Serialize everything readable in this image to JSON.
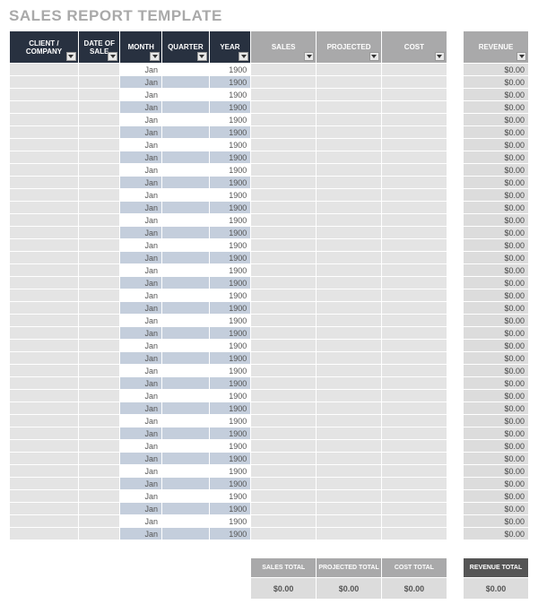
{
  "title": "SALES REPORT TEMPLATE",
  "headers": {
    "client": "CLIENT / COMPANY",
    "date": "DATE OF SALE",
    "month": "MONTH",
    "quarter": "QUARTER",
    "year": "YEAR",
    "sales": "SALES",
    "projected": "PROJECTED",
    "cost": "COST",
    "revenue": "REVENUE"
  },
  "rows": [
    {
      "month": "Jan",
      "year": "1900",
      "revenue": "$0.00"
    },
    {
      "month": "Jan",
      "year": "1900",
      "revenue": "$0.00"
    },
    {
      "month": "Jan",
      "year": "1900",
      "revenue": "$0.00"
    },
    {
      "month": "Jan",
      "year": "1900",
      "revenue": "$0.00"
    },
    {
      "month": "Jan",
      "year": "1900",
      "revenue": "$0.00"
    },
    {
      "month": "Jan",
      "year": "1900",
      "revenue": "$0.00"
    },
    {
      "month": "Jan",
      "year": "1900",
      "revenue": "$0.00"
    },
    {
      "month": "Jan",
      "year": "1900",
      "revenue": "$0.00"
    },
    {
      "month": "Jan",
      "year": "1900",
      "revenue": "$0.00"
    },
    {
      "month": "Jan",
      "year": "1900",
      "revenue": "$0.00"
    },
    {
      "month": "Jan",
      "year": "1900",
      "revenue": "$0.00"
    },
    {
      "month": "Jan",
      "year": "1900",
      "revenue": "$0.00"
    },
    {
      "month": "Jan",
      "year": "1900",
      "revenue": "$0.00"
    },
    {
      "month": "Jan",
      "year": "1900",
      "revenue": "$0.00"
    },
    {
      "month": "Jan",
      "year": "1900",
      "revenue": "$0.00"
    },
    {
      "month": "Jan",
      "year": "1900",
      "revenue": "$0.00"
    },
    {
      "month": "Jan",
      "year": "1900",
      "revenue": "$0.00"
    },
    {
      "month": "Jan",
      "year": "1900",
      "revenue": "$0.00"
    },
    {
      "month": "Jan",
      "year": "1900",
      "revenue": "$0.00"
    },
    {
      "month": "Jan",
      "year": "1900",
      "revenue": "$0.00"
    },
    {
      "month": "Jan",
      "year": "1900",
      "revenue": "$0.00"
    },
    {
      "month": "Jan",
      "year": "1900",
      "revenue": "$0.00"
    },
    {
      "month": "Jan",
      "year": "1900",
      "revenue": "$0.00"
    },
    {
      "month": "Jan",
      "year": "1900",
      "revenue": "$0.00"
    },
    {
      "month": "Jan",
      "year": "1900",
      "revenue": "$0.00"
    },
    {
      "month": "Jan",
      "year": "1900",
      "revenue": "$0.00"
    },
    {
      "month": "Jan",
      "year": "1900",
      "revenue": "$0.00"
    },
    {
      "month": "Jan",
      "year": "1900",
      "revenue": "$0.00"
    },
    {
      "month": "Jan",
      "year": "1900",
      "revenue": "$0.00"
    },
    {
      "month": "Jan",
      "year": "1900",
      "revenue": "$0.00"
    },
    {
      "month": "Jan",
      "year": "1900",
      "revenue": "$0.00"
    },
    {
      "month": "Jan",
      "year": "1900",
      "revenue": "$0.00"
    },
    {
      "month": "Jan",
      "year": "1900",
      "revenue": "$0.00"
    },
    {
      "month": "Jan",
      "year": "1900",
      "revenue": "$0.00"
    },
    {
      "month": "Jan",
      "year": "1900",
      "revenue": "$0.00"
    },
    {
      "month": "Jan",
      "year": "1900",
      "revenue": "$0.00"
    },
    {
      "month": "Jan",
      "year": "1900",
      "revenue": "$0.00"
    },
    {
      "month": "Jan",
      "year": "1900",
      "revenue": "$0.00"
    }
  ],
  "totals": {
    "salesLabel": "SALES TOTAL",
    "projectedLabel": "PROJECTED TOTAL",
    "costLabel": "COST TOTAL",
    "revenueLabel": "REVENUE TOTAL",
    "sales": "$0.00",
    "projected": "$0.00",
    "cost": "$0.00",
    "revenue": "$0.00"
  }
}
